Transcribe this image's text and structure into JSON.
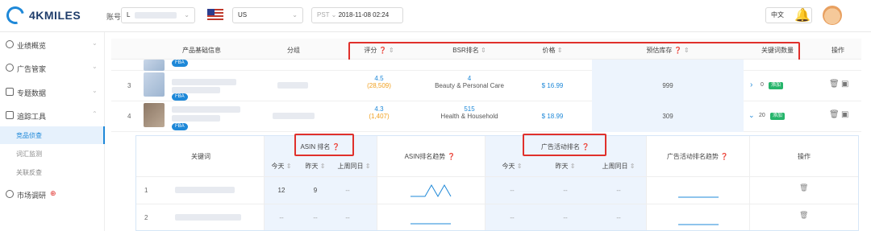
{
  "header": {
    "logo_text": "4KMILES",
    "account_label": "账号",
    "account_value_visible": "L",
    "marketplace": "US",
    "timezone": "PST",
    "datetime": "2018-11-08 02:24",
    "language": "中文"
  },
  "sidebar": {
    "items": [
      {
        "label": "业绩概览"
      },
      {
        "label": "广告管家"
      },
      {
        "label": "专题数据"
      },
      {
        "label": "追踪工具"
      }
    ],
    "subitems": [
      {
        "label": "竞品侦查"
      },
      {
        "label": "词汇监测"
      },
      {
        "label": "关联反查"
      }
    ],
    "market": {
      "label": "市场调研"
    }
  },
  "table": {
    "headers": {
      "product_info": "产品基础信息",
      "group": "分组",
      "rating": "评分",
      "bsr": "BSR排名",
      "price": "价格",
      "stock": "预估库存",
      "keywords": "关键词数量",
      "actions": "操作"
    },
    "rows": [
      {
        "index": "3",
        "fba": "FBA",
        "rating": "4.5",
        "rating_count": "(28,509)",
        "bsr_rank": "4",
        "bsr_category": "Beauty & Personal Care",
        "price": "$ 16.99",
        "stock": "999",
        "keyword_count": "0",
        "add_label": "添加"
      },
      {
        "index": "4",
        "fba": "FBA",
        "rating": "4.3",
        "rating_count": "(1,407)",
        "bsr_rank": "515",
        "bsr_category": "Health & Household",
        "price": "$ 18.99",
        "stock": "309",
        "keyword_count": "20",
        "add_label": "添加"
      }
    ]
  },
  "subtable": {
    "headers": {
      "keyword": "关键词",
      "asin_rank": "ASIN 排名",
      "asin_trend": "ASIN排名趋势",
      "ad_rank": "广告活动排名",
      "ad_trend": "广告活动排名趋势",
      "actions": "操作",
      "today": "今天",
      "yesterday": "昨天",
      "last_week": "上周同日"
    },
    "rows": [
      {
        "index": "1",
        "today": "12",
        "yesterday": "9",
        "last_week": "--",
        "ad_today": "--",
        "ad_yesterday": "--",
        "ad_last_week": "--"
      },
      {
        "index": "2",
        "today": "--",
        "yesterday": "--",
        "last_week": "--",
        "ad_today": "--",
        "ad_yesterday": "--",
        "ad_last_week": "--"
      }
    ]
  },
  "colors": {
    "accent": "#1e88d8",
    "highlight": "#e0302b",
    "rating_count": "#f0a020",
    "tag": "#26b56b"
  }
}
